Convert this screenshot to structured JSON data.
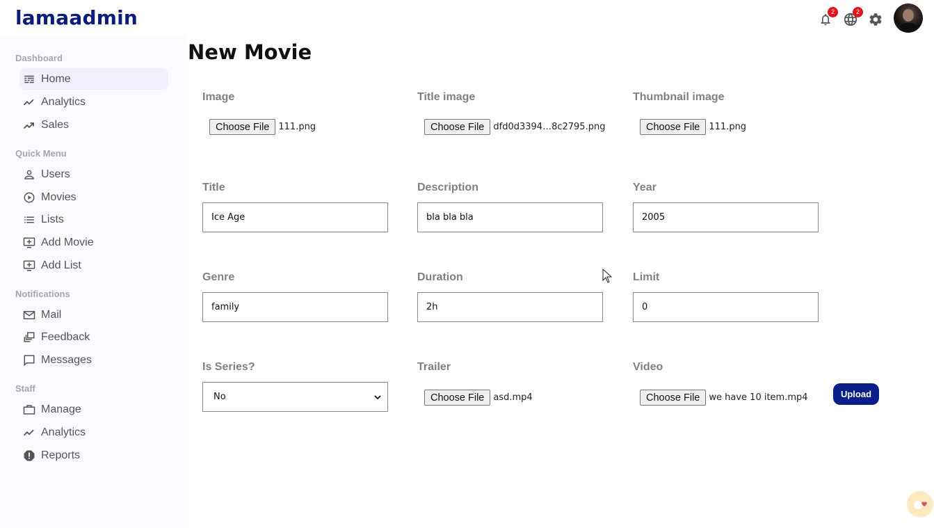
{
  "app": {
    "logo": "lamaadmin"
  },
  "topbar": {
    "notifications": {
      "icon": "bell-icon",
      "badge": "2"
    },
    "language": {
      "icon": "globe-icon",
      "badge": "2"
    },
    "settings": {
      "icon": "gear-icon"
    }
  },
  "sidebar": {
    "sections": [
      {
        "title": "Dashboard",
        "items": [
          {
            "label": "Home",
            "icon": "home-icon",
            "active": true
          },
          {
            "label": "Analytics",
            "icon": "timeline-icon"
          },
          {
            "label": "Sales",
            "icon": "trending-up-icon"
          }
        ]
      },
      {
        "title": "Quick Menu",
        "items": [
          {
            "label": "Users",
            "icon": "user-icon"
          },
          {
            "label": "Movies",
            "icon": "play-circle-icon"
          },
          {
            "label": "Lists",
            "icon": "list-icon"
          },
          {
            "label": "Add Movie",
            "icon": "add-to-queue-icon"
          },
          {
            "label": "Add List",
            "icon": "add-to-queue-icon"
          }
        ]
      },
      {
        "title": "Notifications",
        "items": [
          {
            "label": "Mail",
            "icon": "mail-icon"
          },
          {
            "label": "Feedback",
            "icon": "dynamic-feed-icon"
          },
          {
            "label": "Messages",
            "icon": "chat-bubble-icon"
          }
        ]
      },
      {
        "title": "Staff",
        "items": [
          {
            "label": "Manage",
            "icon": "work-icon"
          },
          {
            "label": "Analytics",
            "icon": "timeline-icon"
          },
          {
            "label": "Reports",
            "icon": "report-icon"
          }
        ]
      }
    ]
  },
  "form": {
    "title": "New Movie",
    "choose_file_label": "Choose File",
    "image": {
      "label": "Image",
      "file": "111.png"
    },
    "title_image": {
      "label": "Title image",
      "file": "dfd0d3394…8c2795.png"
    },
    "thumbnail_image": {
      "label": "Thumbnail image",
      "file": "111.png"
    },
    "title_field": {
      "label": "Title",
      "value": "Ice Age"
    },
    "description": {
      "label": "Description",
      "value": "bla bla bla"
    },
    "year": {
      "label": "Year",
      "value": "2005"
    },
    "genre": {
      "label": "Genre",
      "value": "family"
    },
    "duration": {
      "label": "Duration",
      "value": "2h"
    },
    "limit": {
      "label": "Limit",
      "value": "0"
    },
    "is_series": {
      "label": "Is Series?",
      "value": "No"
    },
    "trailer": {
      "label": "Trailer",
      "file": "asd.mp4"
    },
    "video": {
      "label": "Video",
      "file": "we have 10 item.mp4"
    },
    "upload_label": "Upload"
  },
  "colors": {
    "brand": "#0b1d78",
    "badge": "#e1141b",
    "upload_button": "#0a1e8a"
  }
}
